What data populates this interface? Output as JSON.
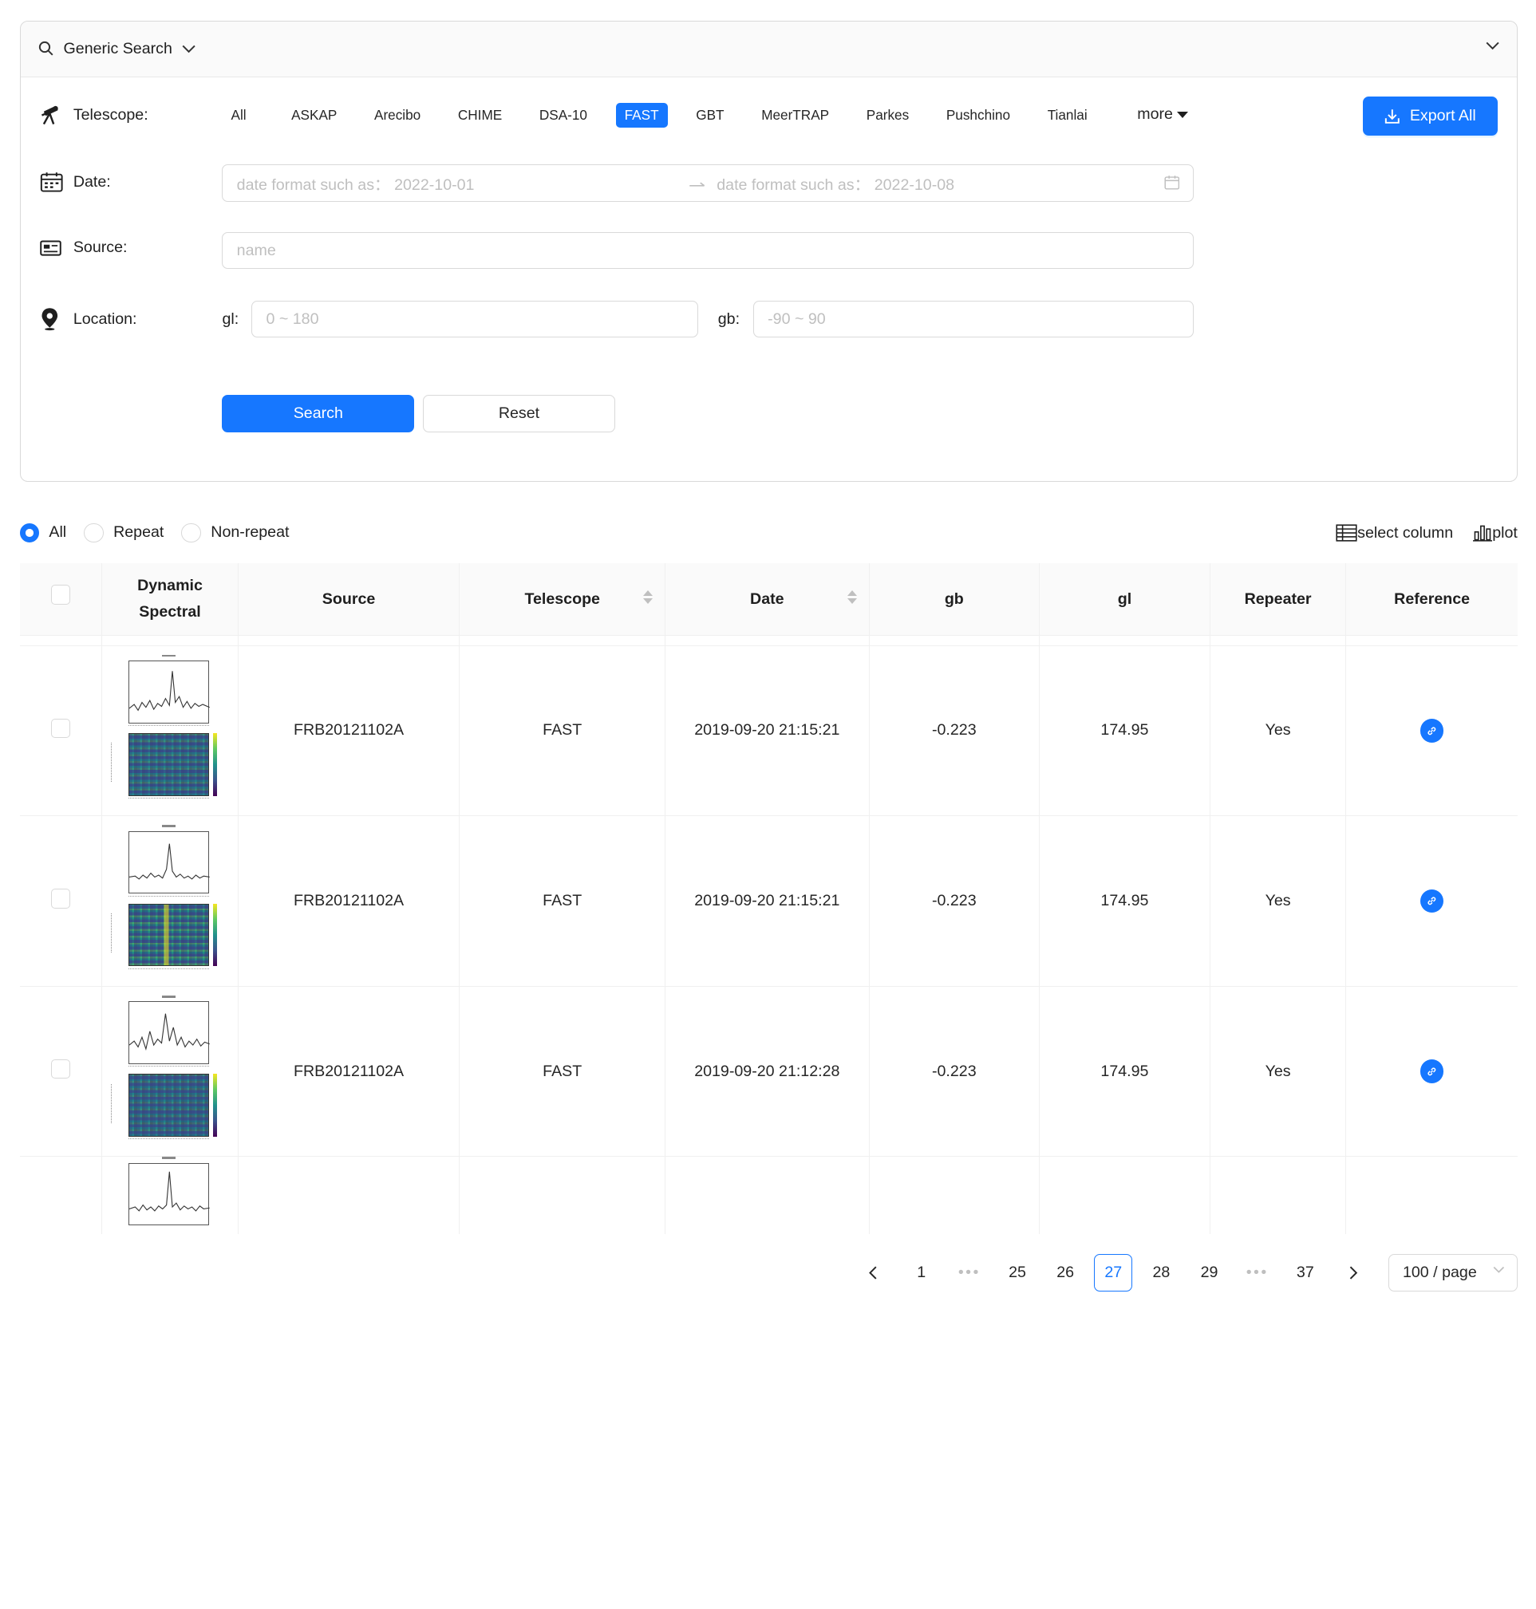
{
  "search_panel": {
    "title": "Generic Search",
    "telescope_label": "Telescope",
    "date_label": "Date",
    "source_label": "Source",
    "location_label": "Location",
    "telescopes": [
      "All",
      "ASKAP",
      "Arecibo",
      "CHIME",
      "DSA-10",
      "FAST",
      "GBT",
      "MeerTRAP",
      "Parkes",
      "Pushchino",
      "Tianlai"
    ],
    "active_telescope": "FAST",
    "more_label": "more",
    "export_label": "Export All",
    "date_start_placeholder": "date format such as： 2022-10-01",
    "date_end_placeholder": "date format such as： 2022-10-08",
    "source_placeholder": "name",
    "gl_label": "gl",
    "gl_placeholder": "0 ~ 180",
    "gb_label": "gb",
    "gb_placeholder": "-90 ~ 90",
    "search_label": "Search",
    "reset_label": "Reset"
  },
  "filters": {
    "options": [
      "All",
      "Repeat",
      "Non-repeat"
    ],
    "selected": "All",
    "select_column_label": "select column",
    "plot_label": "plot"
  },
  "table": {
    "columns": [
      "Dynamic Spectral",
      "Source",
      "Telescope",
      "Date",
      "gb",
      "gl",
      "Repeater",
      "Reference"
    ],
    "dyn_line1": "Dynamic",
    "dyn_line2": "Spectral",
    "rows": [
      {
        "source": "FRB20121102A",
        "telescope": "FAST",
        "date": "2019-09-20 21:15:21",
        "gb": "-0.223",
        "gl": "174.95",
        "repeater": "Yes"
      },
      {
        "source": "FRB20121102A",
        "telescope": "FAST",
        "date": "2019-09-20 21:15:21",
        "gb": "-0.223",
        "gl": "174.95",
        "repeater": "Yes"
      },
      {
        "source": "FRB20121102A",
        "telescope": "FAST",
        "date": "2019-09-20 21:12:28",
        "gb": "-0.223",
        "gl": "174.95",
        "repeater": "Yes"
      }
    ]
  },
  "pagination": {
    "pages": [
      "1",
      "•••",
      "25",
      "26",
      "27",
      "28",
      "29",
      "•••",
      "37"
    ],
    "current": "27",
    "page_size": "100 / page"
  },
  "colors": {
    "primary": "#1677ff",
    "border": "#d9d9d9",
    "header_bg": "#fafafa"
  }
}
